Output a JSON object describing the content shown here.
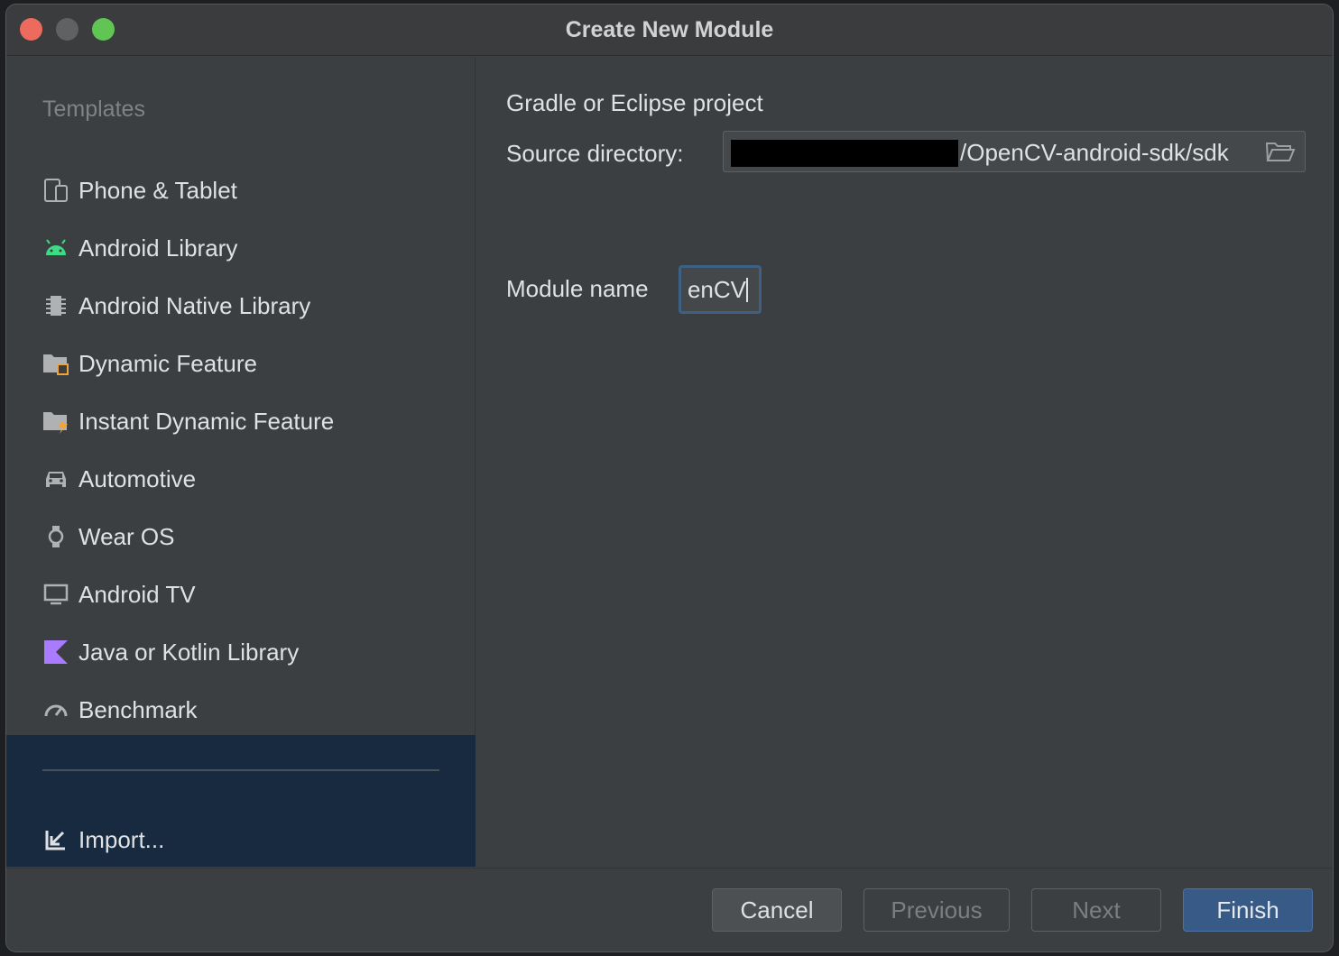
{
  "window": {
    "title": "Create New Module"
  },
  "sidebar": {
    "heading": "Templates",
    "items": [
      {
        "label": "Phone & Tablet",
        "icon": "phone-tablet-icon"
      },
      {
        "label": "Android Library",
        "icon": "android-icon"
      },
      {
        "label": "Android Native Library",
        "icon": "chip-icon"
      },
      {
        "label": "Dynamic Feature",
        "icon": "dynamic-feature-folder-icon"
      },
      {
        "label": "Instant Dynamic Feature",
        "icon": "instant-feature-folder-icon"
      },
      {
        "label": "Automotive",
        "icon": "car-icon"
      },
      {
        "label": "Wear OS",
        "icon": "watch-icon"
      },
      {
        "label": "Android TV",
        "icon": "tv-icon"
      },
      {
        "label": "Java or Kotlin Library",
        "icon": "kotlin-icon"
      },
      {
        "label": "Benchmark",
        "icon": "gauge-icon"
      }
    ],
    "import": {
      "label": "Import...",
      "icon": "import-arrow-icon"
    }
  },
  "content": {
    "section_title": "Gradle or Eclipse project",
    "source_directory": {
      "label": "Source directory:",
      "value": "/OpenCV-android-sdk/sdk"
    },
    "module_name": {
      "label": "Module name",
      "value": "enCV"
    }
  },
  "footer": {
    "cancel": "Cancel",
    "previous": "Previous",
    "next": "Next",
    "finish": "Finish"
  },
  "colors": {
    "accent": "#375a87",
    "selection": "#172a3f",
    "android_green": "#3ddc84",
    "kotlin_purple": "#a97bff"
  }
}
